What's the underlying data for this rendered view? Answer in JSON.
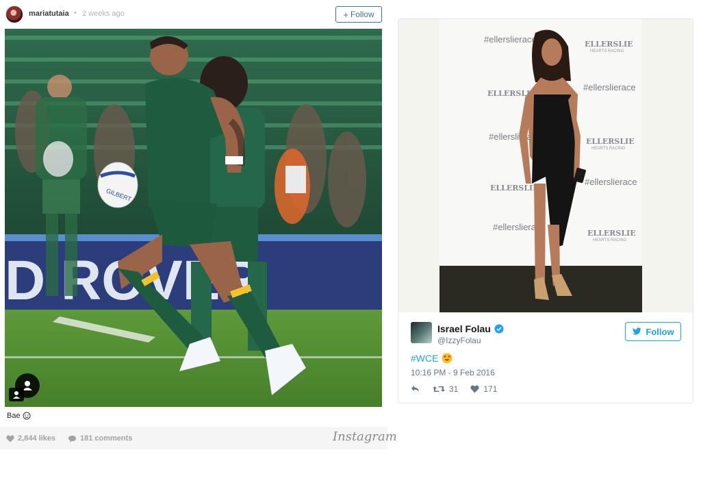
{
  "instagram": {
    "username": "mariatutaia",
    "separator": "•",
    "time_ago": "2 weeks ago",
    "follow_label": "Follow",
    "caption": "Bae",
    "likes": "2,844 likes",
    "comments": "181 comments",
    "logo": "Instagram",
    "photo_sign_text": "D ROVER",
    "ball_text": "GILBERT"
  },
  "twitter": {
    "name": "Israel Folau",
    "handle": "@IzzyFolau",
    "follow_label": "Follow",
    "tweet_text": "#WCE",
    "datetime": "10:16 PM - 9 Feb 2016",
    "retweets": "31",
    "likes": "171",
    "backdrop": {
      "hashtag": "#ellerslierace",
      "brand": "ELLERSLIE",
      "brand_sub": "HEARTS RACING"
    }
  },
  "colors": {
    "ig_blue": "#3f729b",
    "tw_blue": "#1da1f2",
    "verified": "#1da1f2",
    "jersey_green": "#1f5b3f",
    "pitch_green": "#4f8a34"
  }
}
